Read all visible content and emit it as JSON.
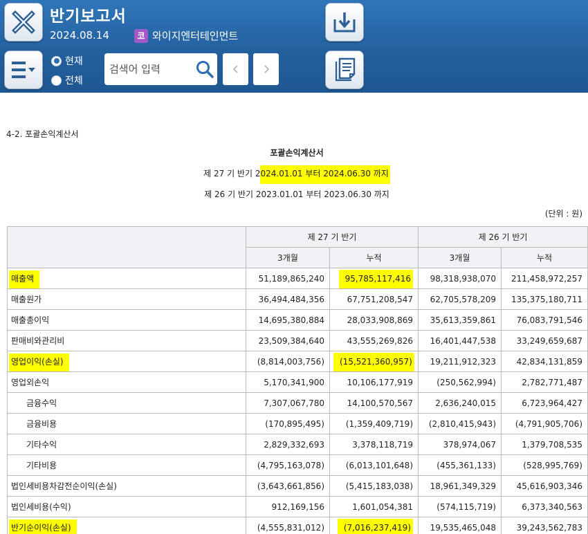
{
  "header": {
    "title": "반기보고서",
    "date": "2024.08.14",
    "corp_type": "코",
    "company": "와이지엔터테인먼트",
    "radio_current": "현재",
    "radio_all": "전체",
    "search_placeholder": "검색어 입력",
    "accent_color": "#2f76b8"
  },
  "content": {
    "section_title": "4-2. 포괄손익계산서",
    "doc_title": "포괄손익계산서",
    "period_current_prefix": "제 27 기 반기 2",
    "period_current_highlight": "024.01.01 부터 2024.06.30 까지",
    "period_prior": "제 26 기 반기 2023.01.01 부터 2023.06.30 까지",
    "unit": "(단위 : 원)"
  },
  "table": {
    "group_headers": [
      "제 27 기 반기",
      "제 26 기 반기"
    ],
    "sub_headers": [
      "3개월",
      "누적",
      "3개월",
      "누적"
    ],
    "rows": [
      {
        "label": "매출액",
        "values": [
          "51,189,865,240",
          "95,785,117,416",
          "98,318,938,070",
          "211,458,972,257"
        ]
      },
      {
        "label": "매출원가",
        "values": [
          "36,494,484,356",
          "67,751,208,547",
          "62,705,578,209",
          "135,375,180,711"
        ]
      },
      {
        "label": "매출총이익",
        "values": [
          "14,695,380,884",
          "28,033,908,869",
          "35,613,359,861",
          "76,083,791,546"
        ]
      },
      {
        "label": "판매비와관리비",
        "values": [
          "23,509,384,640",
          "43,555,269,826",
          "16,401,447,538",
          "33,249,659,687"
        ]
      },
      {
        "label": "영업이익(손실)",
        "values": [
          "(8,814,003,756)",
          "(15,521,360,957)",
          "19,211,912,323",
          "42,834,131,859"
        ]
      },
      {
        "label": "영업외손익",
        "values": [
          "5,170,341,900",
          "10,106,177,919",
          "(250,562,994)",
          "2,782,771,487"
        ]
      },
      {
        "label": "금융수익",
        "values": [
          "7,307,067,780",
          "14,100,570,567",
          "2,636,240,015",
          "6,723,964,427"
        ]
      },
      {
        "label": "금융비용",
        "values": [
          "(170,895,495)",
          "(1,359,409,719)",
          "(2,810,415,943)",
          "(4,791,905,706)"
        ]
      },
      {
        "label": "기타수익",
        "values": [
          "2,829,332,693",
          "3,378,118,719",
          "378,974,067",
          "1,379,708,535"
        ]
      },
      {
        "label": "기타비용",
        "values": [
          "(4,795,163,078)",
          "(6,013,101,648)",
          "(455,361,133)",
          "(528,995,769)"
        ]
      },
      {
        "label": "법인세비용차감전순이익(손실)",
        "values": [
          "(3,643,661,856)",
          "(5,415,183,038)",
          "18,961,349,329",
          "45,616,903,346"
        ]
      },
      {
        "label": "법인세비용(수익)",
        "values": [
          "912,169,156",
          "1,601,054,381",
          "(574,115,719)",
          "6,373,340,563"
        ]
      },
      {
        "label": "반기순이익(손실)",
        "values": [
          "(4,555,831,012)",
          "(7,016,237,419)",
          "19,535,465,048",
          "39,243,562,783"
        ]
      }
    ]
  },
  "highlight_color": "#ffff00"
}
